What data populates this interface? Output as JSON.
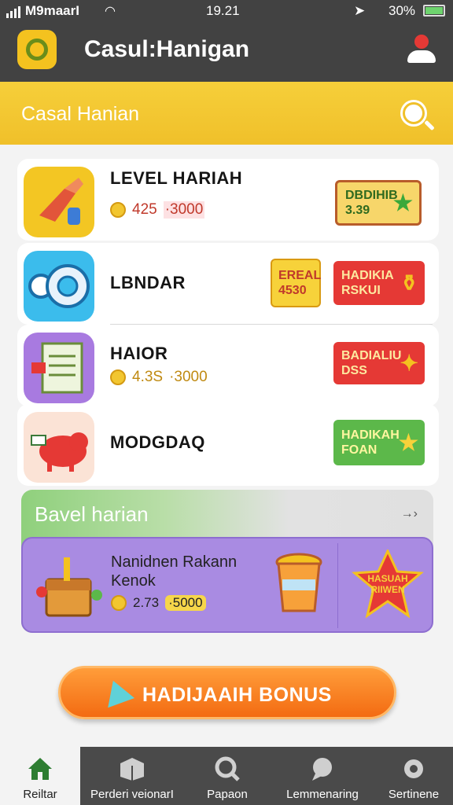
{
  "status_bar": {
    "carrier": "M9maarI",
    "time": "19.21",
    "battery": "30%"
  },
  "app_bar": {
    "title": "Casul:Hanigan"
  },
  "banner": {
    "title": "Casal Hanian"
  },
  "rows": [
    {
      "title": "LEVEL HARIAH",
      "meta_a": "425",
      "meta_b": "·3000",
      "tag_line1": "DBDIHIB",
      "tag_line2": "3.39"
    },
    {
      "title": "LBNDAR",
      "tag1_line1": "EREAL",
      "tag1_line2": "4530",
      "tag2_line1": "HADIKIA",
      "tag2_line2": "RSKUI"
    },
    {
      "title": "HAIOR",
      "meta_a": "4.3S",
      "meta_b": "·3000",
      "tag_line1": "BADIALIU",
      "tag_line2": "DSS"
    },
    {
      "title": "MODGDAQ",
      "tag_line1": "HADIKAH",
      "tag_line2": "FOAN"
    }
  ],
  "level_panel": {
    "title": "Bavel harian",
    "arrow": "→›",
    "item_line1": "Nanidnen Rakann",
    "item_line2": "Kenok",
    "meta_a": "2.73",
    "meta_b": "·5000",
    "badge_line1": "HASUAH",
    "badge_line2": "RIIWEN"
  },
  "cta": {
    "label": "HADIJAAIH BONUS"
  },
  "bottom_nav": [
    {
      "label": "Reiltar"
    },
    {
      "label": "Perderi veionarI"
    },
    {
      "label": "Papaon"
    },
    {
      "label": "Lemmenaring"
    },
    {
      "label": "Sertinene"
    }
  ],
  "colors": {
    "header": "#424242",
    "banner": "#f0c02a",
    "panel": "#a98be2",
    "cta": "#f36b12",
    "tag_red": "#e53935",
    "tag_green": "#5cb84a"
  }
}
